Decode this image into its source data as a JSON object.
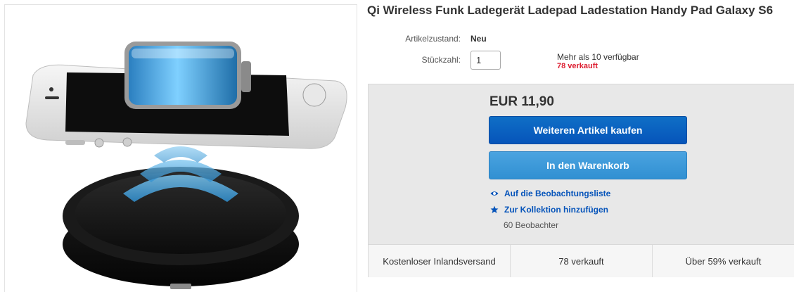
{
  "product": {
    "title": "Qi Wireless Funk Ladegerät Ladepad Ladestation Handy Pad Galaxy S6"
  },
  "details": {
    "condition_label": "Artikelzustand:",
    "condition_value": "Neu",
    "quantity_label": "Stückzahl:",
    "quantity_value": "1",
    "availability": "Mehr als 10 verfügbar",
    "sold": "78 verkauft"
  },
  "buybox": {
    "price": "EUR 11,90",
    "buy_button": "Weiteren Artikel kaufen",
    "cart_button": "In den Warenkorb",
    "watch_link": "Auf die Beobachtungsliste",
    "collection_link": "Zur Kollektion hinzufügen",
    "watchers": "60 Beobachter"
  },
  "stats": [
    "Kostenloser Inlandsversand",
    "78 verkauft",
    "Über 59% verkauft"
  ],
  "icons": {
    "watch": "eye-icon",
    "collection": "star-icon"
  },
  "colors": {
    "link": "#0654ba",
    "buy_button": "#0654ba",
    "cart_button": "#3190d2",
    "sold_red": "#dd1e31"
  }
}
